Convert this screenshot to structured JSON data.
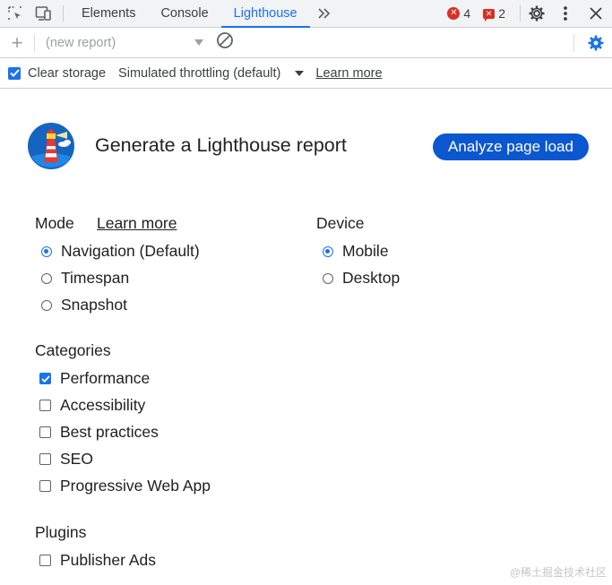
{
  "tabbar": {
    "tabs": [
      {
        "label": "Elements"
      },
      {
        "label": "Console"
      },
      {
        "label": "Lighthouse"
      }
    ],
    "error_count": "4",
    "issue_count": "2"
  },
  "toolbar": {
    "report_select": "(new report)"
  },
  "options": {
    "clear_storage": "Clear storage",
    "throttling": "Simulated throttling (default)",
    "learn_more": "Learn more"
  },
  "main": {
    "title": "Generate a Lighthouse report",
    "analyze_button": "Analyze page load"
  },
  "mode": {
    "heading": "Mode",
    "learn_more": "Learn more",
    "options": [
      "Navigation (Default)",
      "Timespan",
      "Snapshot"
    ],
    "selected": "Navigation (Default)"
  },
  "device": {
    "heading": "Device",
    "options": [
      "Mobile",
      "Desktop"
    ],
    "selected": "Mobile"
  },
  "categories": {
    "heading": "Categories",
    "items": [
      "Performance",
      "Accessibility",
      "Best practices",
      "SEO",
      "Progressive Web App"
    ],
    "checked": [
      "Performance"
    ]
  },
  "plugins": {
    "heading": "Plugins",
    "items": [
      "Publisher Ads"
    ]
  },
  "watermark": "@稀土掘金技术社区",
  "colors": {
    "accent": "#1a73e8",
    "button": "#0b57d0",
    "error": "#d93025"
  }
}
